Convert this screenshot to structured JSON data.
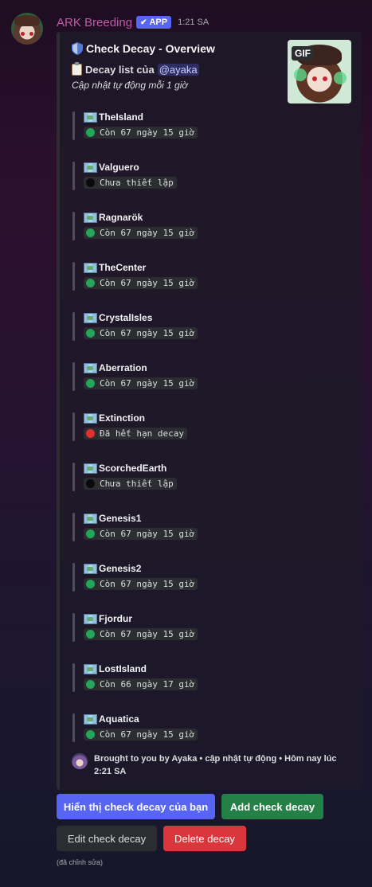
{
  "message": {
    "username": "ARK Breeding",
    "app_badge": "APP",
    "timestamp": "1:21 SA",
    "edited_note": "(đã chỉnh sửa)"
  },
  "embed": {
    "title": "Check Decay - Overview",
    "thumbnail_badge": "GIF",
    "description_label": "Decay list của",
    "mention": "@ayaka",
    "subtitle": "Cập nhật tự động mỗi 1 giờ",
    "maps": [
      {
        "name": "TheIsland",
        "status": "Còn 67 ngày 15 giờ",
        "dot": "green"
      },
      {
        "name": "Valguero",
        "status": "Chưa thiết lập",
        "dot": "black"
      },
      {
        "name": "Ragnarök",
        "status": "Còn 67 ngày 15 giờ",
        "dot": "green"
      },
      {
        "name": "TheCenter",
        "status": "Còn 67 ngày 15 giờ",
        "dot": "green"
      },
      {
        "name": "CrystalIsles",
        "status": "Còn 67 ngày 15 giờ",
        "dot": "green"
      },
      {
        "name": "Aberration",
        "status": "Còn 67 ngày 15 giờ",
        "dot": "green"
      },
      {
        "name": "Extinction",
        "status": "Đã hết hạn decay",
        "dot": "red"
      },
      {
        "name": "ScorchedEarth",
        "status": "Chưa thiết lập",
        "dot": "black"
      },
      {
        "name": "Genesis1",
        "status": "Còn 67 ngày 15 giờ",
        "dot": "green"
      },
      {
        "name": "Genesis2",
        "status": "Còn 67 ngày 15 giờ",
        "dot": "green"
      },
      {
        "name": "Fjordur",
        "status": "Còn 67 ngày 15 giờ",
        "dot": "green"
      },
      {
        "name": "LostIsland",
        "status": "Còn 66 ngày 17 giờ",
        "dot": "green"
      },
      {
        "name": "Aquatica",
        "status": "Còn 67 ngày 15 giờ",
        "dot": "green"
      }
    ],
    "footer": "Brought to you by Ayaka • cập nhật tự động • Hôm nay lúc 2:21 SA"
  },
  "buttons": {
    "show_mine": "Hiển thị check decay của bạn",
    "add": "Add check decay",
    "edit": "Edit check decay",
    "delete": "Delete decay"
  },
  "colors": {
    "blurple": "#5865f2",
    "green_button": "#248046",
    "red_button": "#da373c",
    "status_green": "#23a55a",
    "status_red": "#e0302f",
    "username": "#c15aa8"
  }
}
